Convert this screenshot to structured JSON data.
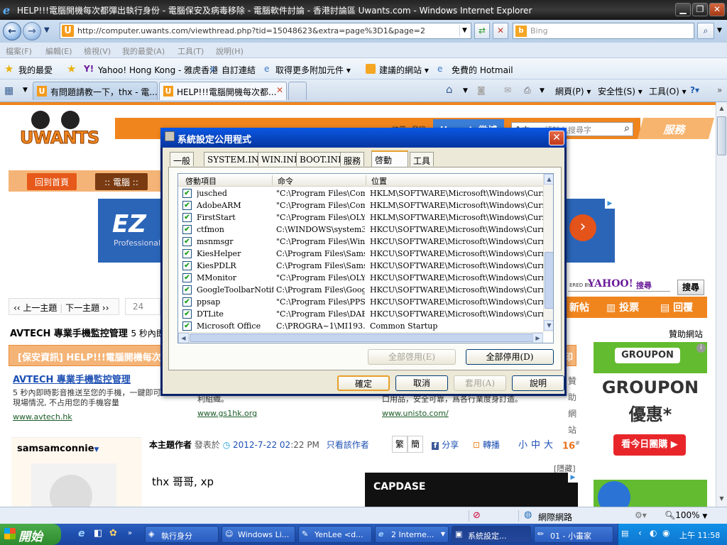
{
  "window": {
    "title": "HELP!!!電腦開機每次都彈出執行身份 - 電腦保安及病毒移除 - 電腦軟件討論 - 香港討論區 Uwants.com - Windows Internet Explorer",
    "min": "▁",
    "max": "❐",
    "close": "✕"
  },
  "address": {
    "url": "http://computer.uwants.com/viewthread.php?tid=15048623&extra=page%3D1&page=2",
    "search_placeholder": "Bing"
  },
  "menu": [
    "檔案(F)",
    "編輯(E)",
    "檢視(V)",
    "我的最愛(A)",
    "工具(T)",
    "說明(H)"
  ],
  "favbar": {
    "favorites": "我的最愛",
    "items": [
      "Yahoo! Hong Kong - 雅虎香港",
      "自訂連結",
      "取得更多附加元件 ▾",
      "建議的網站 ▾",
      "免費的 Hotmail"
    ]
  },
  "tabs": [
    {
      "label": "有問題請教一下，thx - 電..."
    },
    {
      "label": "HELP!!!電腦開機每次都..."
    }
  ],
  "commandbar": [
    "網頁(P) ▾",
    "安全性(S) ▾",
    "工具(O) ▾"
  ],
  "page": {
    "logo": "UWANTS",
    "header_links": [
      "註冊",
      "登錄"
    ],
    "search_placeholder": "請輸入搜尋字",
    "search_scope": "全文",
    "service": "服務",
    "uwants_badge": "Uwants微博",
    "back_home": "回到首頁",
    "breadcrumb_1": ":: 電腦 ::",
    "ad_brand": "EZ",
    "ad_sub": "Professional",
    "prev_topic": "‹‹ 上一主題",
    "next_topic": "下一主題 ››",
    "page_num": "24",
    "new_post": "新帖",
    "vote": "投票",
    "reply": "回覆",
    "yahoo_powered": "ERED BY",
    "yahoo": "YAHOO!",
    "yahoo_search": "搜尋",
    "search_btn": "搜尋",
    "sponsor_title": "AVTECH 專業手機監控管理",
    "sponsor_inline": "5 秒內即",
    "sponsor_label": "贊助網站",
    "topic_prefix": "[保安資訊] HELP!!!電腦開機每次",
    "topic_suffix": "印",
    "ads": [
      {
        "title": "AVTECH 專業手機監控管理",
        "desc": "5 秒內即時影音推送至您的手機，一鍵即可\n現場情況, 不占用您的手機容量",
        "url": "www.avtech.hk"
      },
      {
        "title": "",
        "desc": "利組織。",
        "url": "www.gs1hk.org"
      },
      {
        "title": "",
        "desc": "口用品，安全可靠，爲各行業度身訂造。",
        "url": "www.unisto.com/"
      }
    ],
    "side_vertical": "贊助網站",
    "username": "samsamconnie",
    "author_label": "本主題作者",
    "posted_at": "發表於",
    "datetime": "2012-7-22 02",
    "time_tail": ":22 PM",
    "only_author": "只看該作者",
    "trad": "繁",
    "simp": "簡",
    "share": "分享",
    "forward": "轉播",
    "font_sizes": [
      "小",
      "中",
      "大"
    ],
    "floor": "16",
    "hidden": "[隱藏]",
    "post_body": "thx 哥哥, xp",
    "capdase": "CAPDASE",
    "groupon": "GROUPON",
    "groupon_big": "GROUPON",
    "groupon_sub": "優惠*",
    "groupon_btn": "看今日團購 ▶"
  },
  "dialog": {
    "title": "系統設定公用程式",
    "tabs": [
      "一般",
      "SYSTEM.INI",
      "WIN.INI",
      "BOOT.INI",
      "服務",
      "啓動",
      "工具"
    ],
    "selected_tab": "啓動",
    "columns": [
      "啓動項目",
      "命令",
      "位置"
    ],
    "rows": [
      {
        "name": "jusched",
        "cmd": "\"C:\\Program Files\\Com...",
        "loc": "HKLM\\SOFTWARE\\Microsoft\\Windows\\CurrentV..."
      },
      {
        "name": "AdobeARM",
        "cmd": "\"C:\\Program Files\\Com...",
        "loc": "HKLM\\SOFTWARE\\Microsoft\\Windows\\CurrentV..."
      },
      {
        "name": "FirstStart",
        "cmd": "\"C:\\Program Files\\OLY...",
        "loc": "HKLM\\SOFTWARE\\Microsoft\\Windows\\CurrentV..."
      },
      {
        "name": "ctfmon",
        "cmd": "C:\\WINDOWS\\system3...",
        "loc": "HKCU\\SOFTWARE\\Microsoft\\Windows\\CurrentVe"
      },
      {
        "name": "msnmsgr",
        "cmd": "\"C:\\Program Files\\Win...",
        "loc": "HKCU\\SOFTWARE\\Microsoft\\Windows\\CurrentVe"
      },
      {
        "name": "KiesHelper",
        "cmd": "C:\\Program Files\\Samsu...",
        "loc": "HKCU\\SOFTWARE\\Microsoft\\Windows\\CurrentVe"
      },
      {
        "name": "KiesPDLR",
        "cmd": "C:\\Program Files\\Samsu...",
        "loc": "HKCU\\SOFTWARE\\Microsoft\\Windows\\CurrentVe"
      },
      {
        "name": "MMonitor",
        "cmd": "\"C:\\Program Files\\OLY...",
        "loc": "HKCU\\SOFTWARE\\Microsoft\\Windows\\CurrentVe"
      },
      {
        "name": "GoogleToolbarNotif...",
        "cmd": "C:\\Program Files\\Googl...",
        "loc": "HKCU\\SOFTWARE\\Microsoft\\Windows\\CurrentVe"
      },
      {
        "name": "ppsap",
        "cmd": "\"C:\\Program Files\\PPStre...",
        "loc": "HKCU\\SOFTWARE\\Microsoft\\Windows\\CurrentVe"
      },
      {
        "name": "DTLite",
        "cmd": "\"C:\\Program Files\\DAE...",
        "loc": "HKCU\\SOFTWARE\\Microsoft\\Windows\\CurrentVe"
      },
      {
        "name": "Microsoft Office",
        "cmd": "C:\\PROGRA~1\\MI193...",
        "loc": "Common Startup"
      }
    ],
    "enable_all": "全部啓用(E)",
    "disable_all": "全部停用(D)",
    "ok": "確定",
    "cancel": "取消",
    "apply": "套用(A)",
    "help": "說明"
  },
  "statusbar": {
    "zone": "網際網路",
    "zoom": "100%"
  },
  "taskbar": {
    "start": "開始",
    "tasks": [
      "執行身分",
      "Windows Li...",
      "YenLee <d...",
      "2 Interne...",
      "系統設定...",
      "01 - 小畫家"
    ],
    "clock": "上午 11:58"
  },
  "colors": {
    "accent_orange": "#f0851e",
    "xp_blue": "#0a58e6",
    "groupon_green": "#63bb2f"
  }
}
